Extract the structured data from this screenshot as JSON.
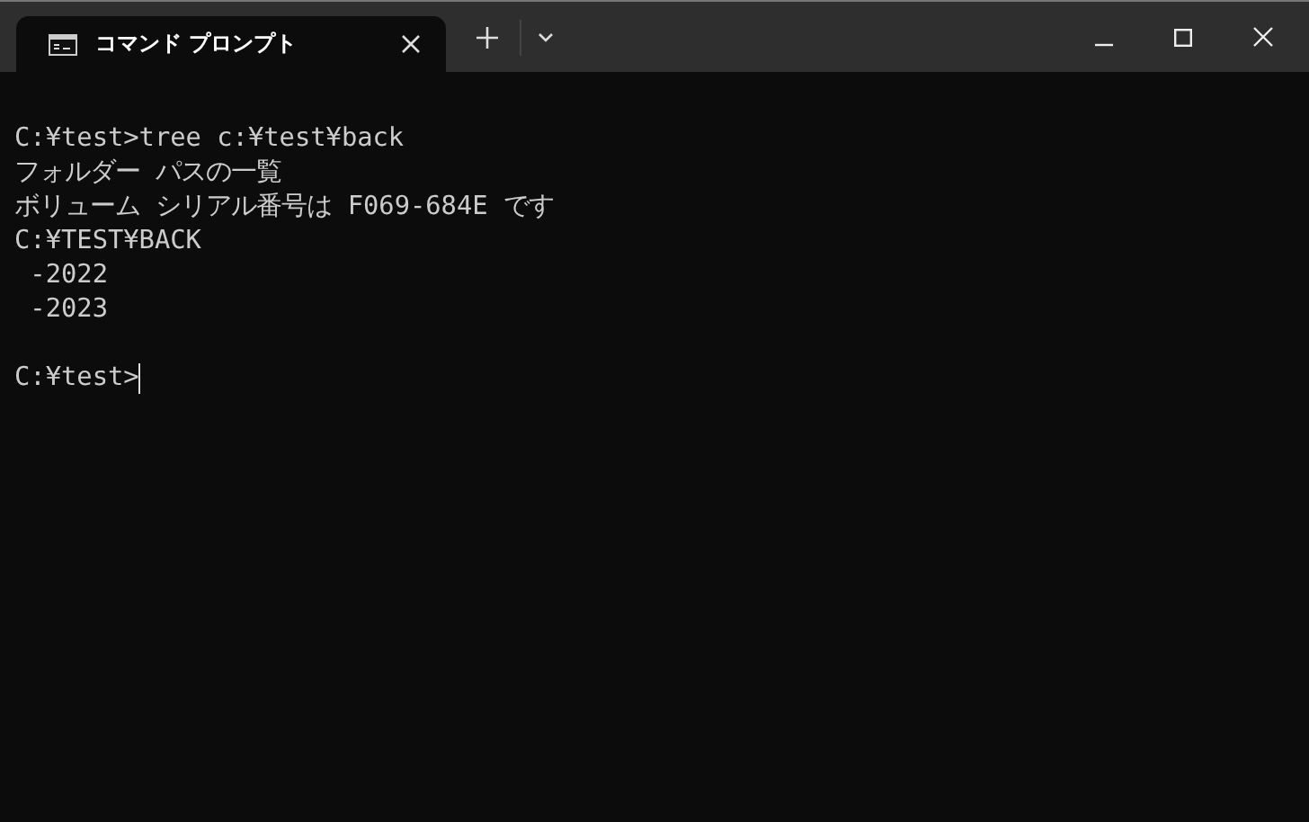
{
  "tabs": [
    {
      "title": "コマンド プロンプト",
      "selected": true
    }
  ],
  "console": {
    "lines": [
      {
        "kind": "blank"
      },
      {
        "kind": "output",
        "text": "C:¥test>tree c:¥test¥back"
      },
      {
        "kind": "output",
        "text": "フォルダー パスの一覧"
      },
      {
        "kind": "output",
        "text": "ボリューム シリアル番号は F069-684E です"
      },
      {
        "kind": "output",
        "text": "C:¥TEST¥BACK"
      },
      {
        "kind": "output",
        "text": " -2022"
      },
      {
        "kind": "output",
        "text": " -2023"
      },
      {
        "kind": "blank"
      },
      {
        "kind": "prompt",
        "text": "C:¥test>"
      }
    ]
  }
}
